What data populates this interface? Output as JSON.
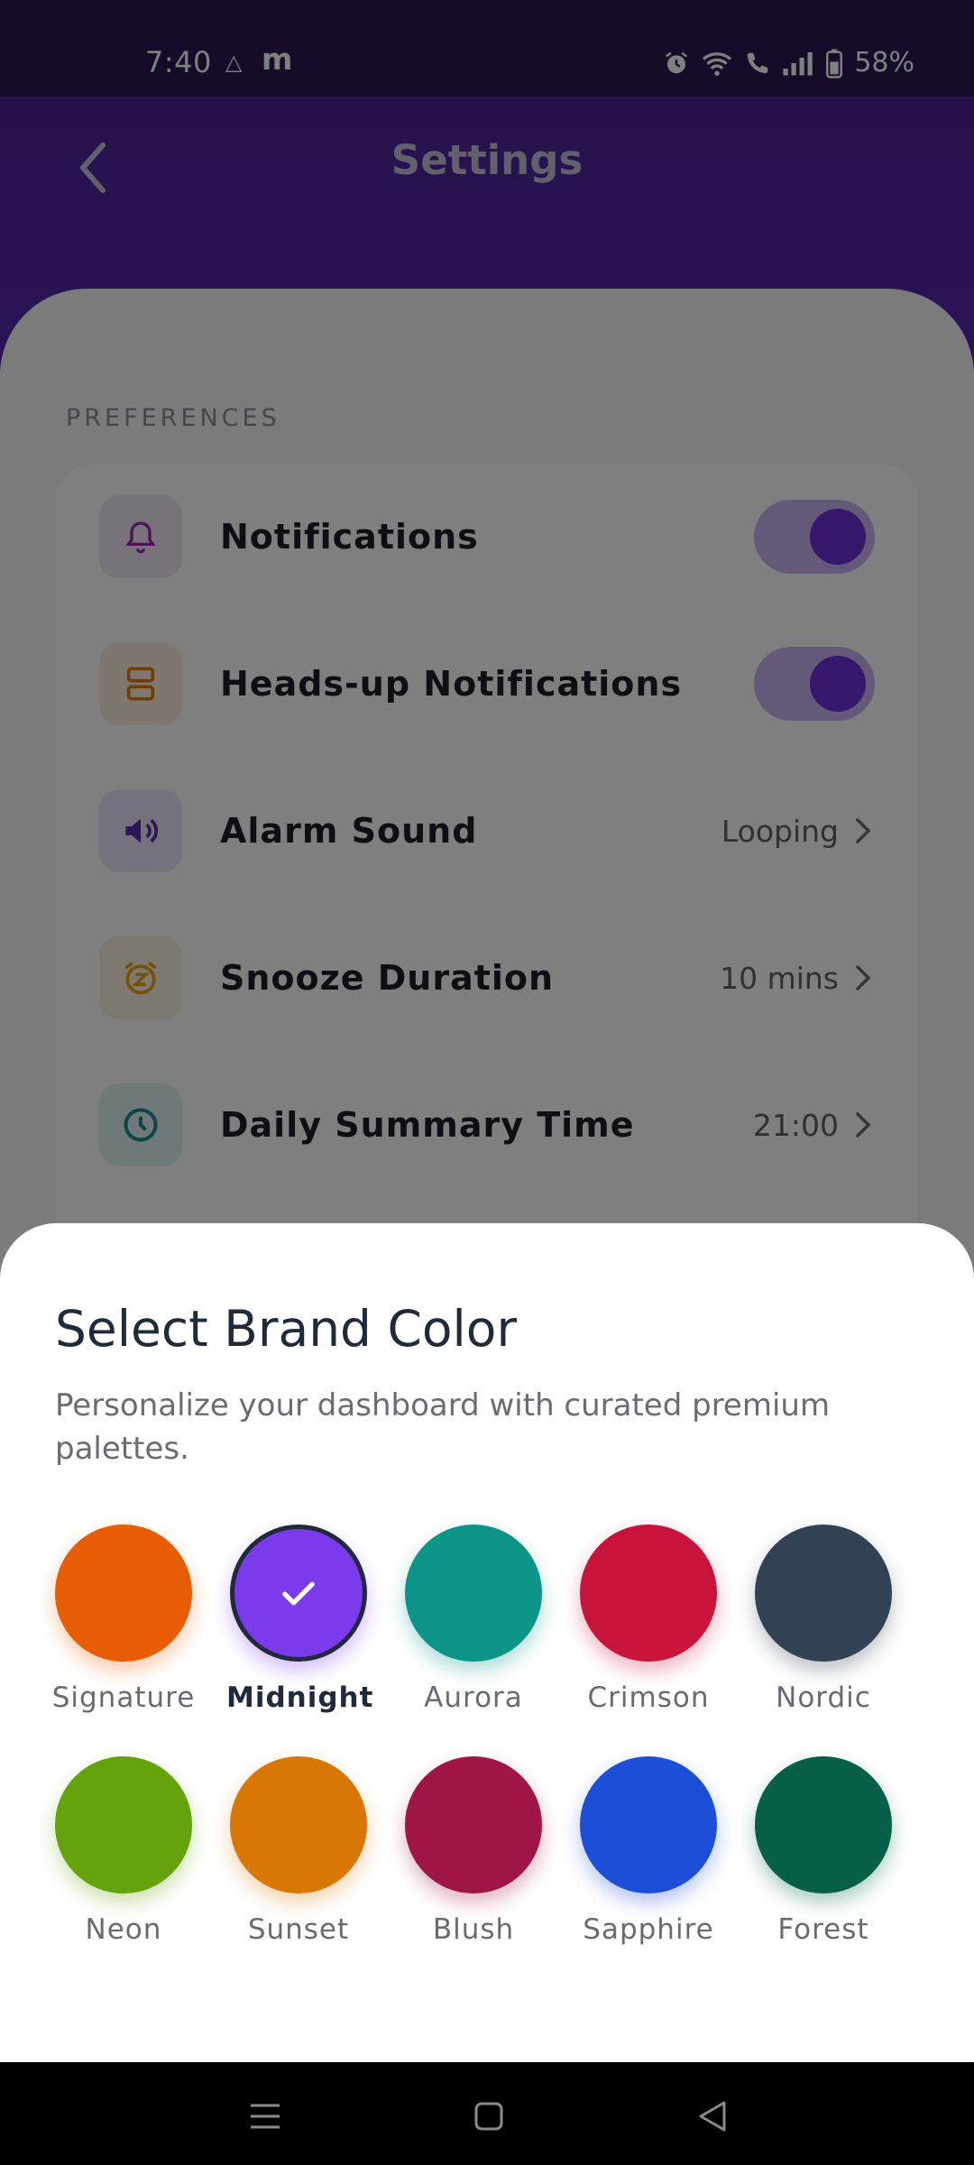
{
  "status_bar": {
    "time": "7:40",
    "app_icon_1": "△",
    "app_icon_2": "m",
    "battery": "58%"
  },
  "header": {
    "title": "Settings"
  },
  "preferences": {
    "section_label": "PREFERENCES",
    "items": [
      {
        "label": "Notifications",
        "icon": "bell-icon",
        "type": "toggle",
        "enabled": true,
        "icon_bg": "#f1e4f7",
        "icon_color": "#9c27b0"
      },
      {
        "label": "Heads-up Notifications",
        "icon": "heads-up-icon",
        "type": "toggle",
        "enabled": true,
        "icon_bg": "#fdeede",
        "icon_color": "#e07b12"
      },
      {
        "label": "Alarm Sound",
        "icon": "speaker-icon",
        "type": "value",
        "value": "Looping",
        "icon_bg": "#ece5fb",
        "icon_color": "#5b2bb5"
      },
      {
        "label": "Snooze Duration",
        "icon": "alarm-clock-icon",
        "type": "value",
        "value": "10 mins",
        "icon_bg": "#fdf2dc",
        "icon_color": "#e6a117"
      },
      {
        "label": "Daily Summary Time",
        "icon": "clock-icon",
        "type": "value",
        "value": "21:00",
        "icon_bg": "#dff2f3",
        "icon_color": "#1a8a93"
      }
    ]
  },
  "sheet": {
    "title": "Select Brand Color",
    "subtitle": "Personalize your dashboard with curated premium palettes.",
    "selected": "Midnight",
    "colors": [
      {
        "name": "Signature",
        "hex": "#e85d04"
      },
      {
        "name": "Midnight",
        "hex": "#7c3aed"
      },
      {
        "name": "Aurora",
        "hex": "#0d9488"
      },
      {
        "name": "Crimson",
        "hex": "#c8143b"
      },
      {
        "name": "Nordic",
        "hex": "#334155"
      },
      {
        "name": "Neon",
        "hex": "#65a30d"
      },
      {
        "name": "Sunset",
        "hex": "#d97706"
      },
      {
        "name": "Blush",
        "hex": "#9f1548"
      },
      {
        "name": "Sapphire",
        "hex": "#1d4ed8"
      },
      {
        "name": "Forest",
        "hex": "#065f46"
      }
    ]
  },
  "nav": {
    "buttons": [
      "menu-icon",
      "home-icon",
      "back-icon"
    ]
  }
}
